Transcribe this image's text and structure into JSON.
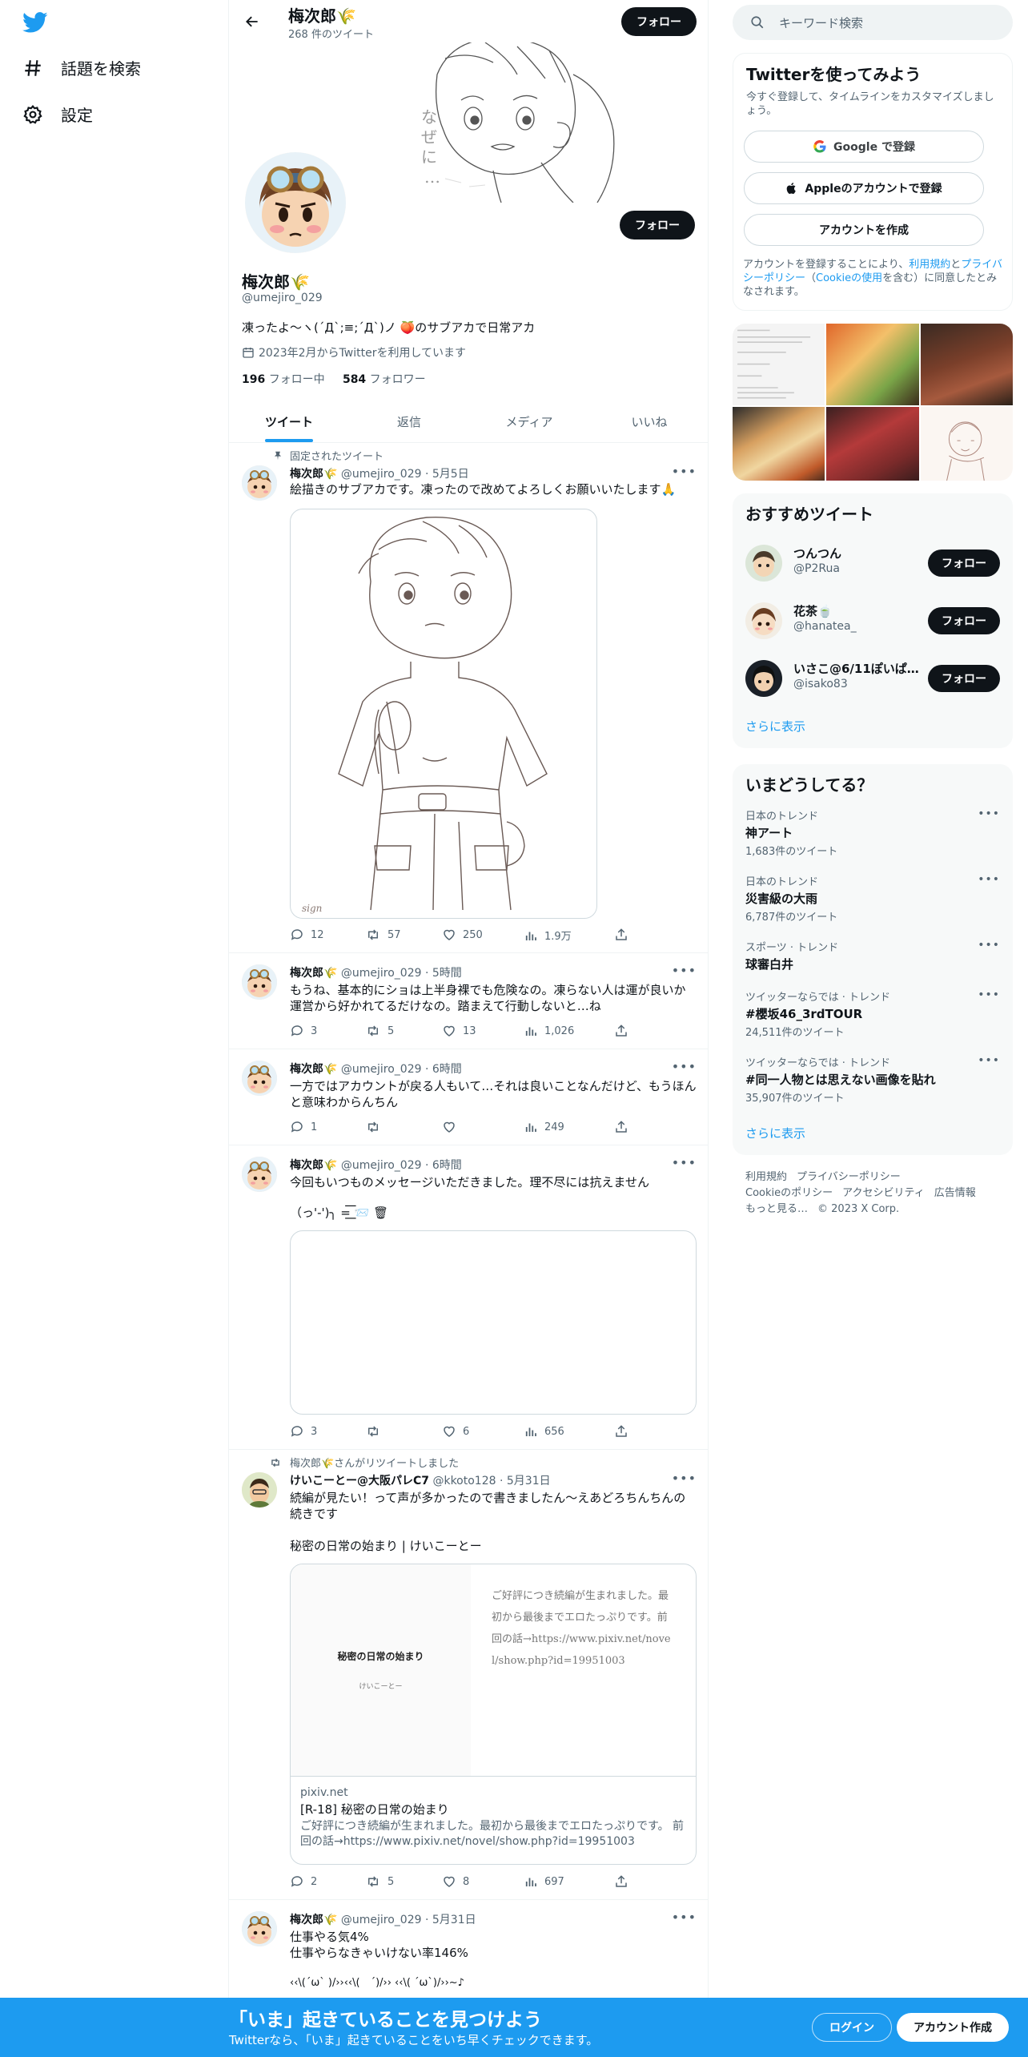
{
  "nav": {
    "explore_label": "話題を検索",
    "settings_label": "設定"
  },
  "header": {
    "name": "梅次郎🌾",
    "tweet_count": "268 件のツイート",
    "follow_label": "フォロー"
  },
  "profile": {
    "name": "梅次郎🌾",
    "handle": "@umejiro_029",
    "bio": "凍ったよ～ヽ(´Д`;≡;´Д`)ノ 🍑のサブアカで日常アカ",
    "joined": "2023年2月からTwitterを利用しています",
    "following_count": "196",
    "following_label": "フォロー中",
    "followers_count": "584",
    "followers_label": "フォロワー",
    "follow_label": "フォロー",
    "banner_text": "なぜに・・・"
  },
  "tabs": [
    "ツイート",
    "返信",
    "メディア",
    "いいね"
  ],
  "tweets": [
    {
      "social": "固定されたツイート",
      "name": "梅次郎🌾",
      "handle": "@umejiro_029",
      "time": "5月5日",
      "text": "絵描きのサブアカです。凍ったので改めてよろしくお願いいたします🙏",
      "stats": {
        "reply": "12",
        "retweet": "57",
        "like": "250",
        "views": "1.9万"
      }
    },
    {
      "name": "梅次郎🌾",
      "handle": "@umejiro_029",
      "time": "5時間",
      "text": "もうね、基本的にショは上半身裸でも危険なの。凍らない人は運が良いか運営から好かれてるだけなの。踏まえて行動しないと…ね",
      "stats": {
        "reply": "3",
        "retweet": "5",
        "like": "13",
        "views": "1,026"
      }
    },
    {
      "name": "梅次郎🌾",
      "handle": "@umejiro_029",
      "time": "6時間",
      "text": "一方ではアカウントが戻る人もいて…それは良いことなんだけど、もうほんと意味わからんちん",
      "stats": {
        "reply": "1",
        "retweet": "",
        "like": "",
        "views": "249"
      }
    },
    {
      "name": "梅次郎🌾",
      "handle": "@umejiro_029",
      "time": "6時間",
      "text": "今回もいつものメッセージいただきました。理不尽には抗えません",
      "text2": "（っ'-')╮ =͟͟͞͞ 📨 🗑",
      "stats": {
        "reply": "3",
        "retweet": "",
        "like": "6",
        "views": "656"
      }
    },
    {
      "social": "梅次郎🌾さんがリツイートしました",
      "name": "けいこーとー@大阪パレC7",
      "handle": "@kkoto128",
      "time": "5月31日",
      "text": "続編が見たい！って声が多かったので書きましたん〜えあどろちんちんの続きです",
      "text2": "秘密の日常の始まり | けいこーとー",
      "card": {
        "img_title": "秘密の日常の始まり",
        "img_author": "けいこーとー",
        "img_text": "ご好評につき続編が生まれました。最初から最後までエロたっぷりです。前回の話→https://www.pixiv.net/novel/show.php?id=19951003",
        "domain": "pixiv.net",
        "title": "[R-18] 秘密の日常の始まり",
        "desc": "ご好評につき続編が生まれました。最初から最後までエロたっぷりです。 前回の話→https://www.pixiv.net/novel/show.php?id=19951003"
      },
      "stats": {
        "reply": "2",
        "retweet": "5",
        "like": "8",
        "views": "697"
      }
    },
    {
      "name": "梅次郎🌾",
      "handle": "@umejiro_029",
      "time": "5月31日",
      "text": "仕事やる気4%",
      "text2": "仕事やらなきゃいけない率146%",
      "text3": "‹‹\\(´ω` )/››‹‹\\(　´)/›› ‹‹\\( ´ω`)/››~♪"
    }
  ],
  "search": {
    "placeholder": "キーワード検索"
  },
  "signup": {
    "title": "Twitterを使ってみよう",
    "subtitle": "今すぐ登録して、タイムラインをカスタマイズしましょう。",
    "google": "Google で登録",
    "apple": "Appleのアカウントで登録",
    "create": "アカウントを作成",
    "legal_1": "アカウントを登録することにより、",
    "legal_terms": "利用規約",
    "legal_2": "と",
    "legal_privacy": "プライバシーポリシー",
    "legal_3": "（",
    "legal_cookie": "Cookieの使用",
    "legal_4": "を含む）に同意したとみなされます。"
  },
  "who_to_follow": {
    "title": "おすすめツイート",
    "users": [
      {
        "name": "つんつん",
        "handle": "@P2Rua",
        "button": "フォロー"
      },
      {
        "name": "花茶🍵",
        "handle": "@hanatea_",
        "button": "フォロー"
      },
      {
        "name": "いさこ@6/11ぽいぱ…",
        "handle": "@isako83",
        "button": "フォロー"
      }
    ],
    "show_more": "さらに表示"
  },
  "trends": {
    "title": "いまどうしてる？",
    "items": [
      {
        "category": "日本のトレンド",
        "name": "神アート",
        "count": "1,683件のツイート"
      },
      {
        "category": "日本のトレンド",
        "name": "災害級の大雨",
        "count": "6,787件のツイート"
      },
      {
        "category": "スポーツ · トレンド",
        "name": "球審白井",
        "count": ""
      },
      {
        "category": "ツイッターならでは · トレンド",
        "name": "#櫻坂46_3rdTOUR",
        "count": "24,511件のツイート"
      },
      {
        "category": "ツイッターならでは · トレンド",
        "name": "#同一人物とは思えない画像を貼れ",
        "count": "35,907件のツイート"
      }
    ],
    "show_more": "さらに表示"
  },
  "footer": {
    "links": [
      "利用規約",
      "プライバシーポリシー",
      "Cookieのポリシー",
      "アクセシビリティ",
      "広告情報",
      "もっと見る…",
      "© 2023 X Corp."
    ]
  },
  "bottombar": {
    "title": "「いま」起きていることを見つけよう",
    "subtitle": "Twitterなら、「いま」起きていることをいち早くチェックできます。",
    "login": "ログイン",
    "signup": "アカウント作成"
  },
  "colors": {
    "accent": "#1d9bf0",
    "text": "#0f1419",
    "muted": "#536471"
  }
}
